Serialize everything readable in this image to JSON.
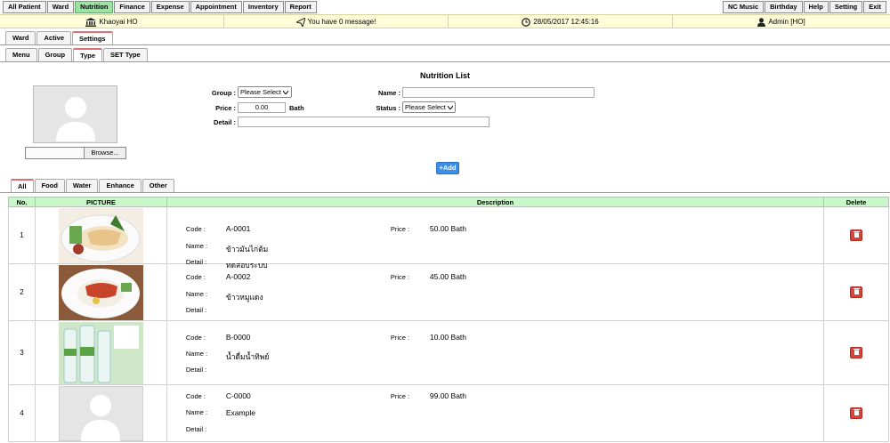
{
  "top_nav": {
    "left": [
      "All Patient",
      "Ward",
      "Nutrition",
      "Finance",
      "Expense",
      "Appointment",
      "Inventory",
      "Report"
    ],
    "right": [
      "NC Music",
      "Birthday",
      "Help",
      "Setting",
      "Exit"
    ],
    "active": "Nutrition"
  },
  "info_bar": {
    "branch": "Khaoyai HO",
    "message": "You have 0 message!",
    "datetime": "28/05/2017 12:45:16",
    "user": "Admin [HO]"
  },
  "tabs_level1": [
    "Ward",
    "Active",
    "Settings"
  ],
  "tabs_level2": [
    "Menu",
    "Group",
    "Type",
    "SET Type"
  ],
  "form": {
    "title": "Nutrition List",
    "group_label": "Group :",
    "group_value": "Please Select",
    "name_label": "Name :",
    "name_value": "",
    "price_label": "Price :",
    "price_value": "0.00",
    "price_unit": "Bath",
    "status_label": "Status :",
    "status_value": "Please Select",
    "detail_label": "Detail :",
    "detail_value": "",
    "browse_label": "Browse...",
    "add_label": "+Add"
  },
  "filter_tabs": [
    "All",
    "Food",
    "Water",
    "Enhance",
    "Other"
  ],
  "table": {
    "headers": [
      "No.",
      "PICTURE",
      "Description",
      "Delete"
    ],
    "code_label": "Code :",
    "name_label": "Name :",
    "detail_label": "Detail :",
    "price_label": "Price :",
    "rows": [
      {
        "no": "1",
        "code": "A-0001",
        "name": "ข้าวมันไก่ต้ม",
        "detail": "ทดสอบระบบ",
        "price": "50.00 Bath",
        "picture": "chicken-rice"
      },
      {
        "no": "2",
        "code": "A-0002",
        "name": "ข้าวหมูแดง",
        "detail": "",
        "price": "45.00 Bath",
        "picture": "red-pork-rice"
      },
      {
        "no": "3",
        "code": "B-0000",
        "name": "น้ำดื่มน้ำทิพย์",
        "detail": "",
        "price": "10.00 Bath",
        "picture": "water-bottles"
      },
      {
        "no": "4",
        "code": "C-0000",
        "name": "Example",
        "detail": "",
        "price": "99.00 Bath",
        "picture": "placeholder"
      }
    ]
  },
  "colors": {
    "active_nav": "#9fe0a6",
    "header_green": "#c9f7c9",
    "info_bg": "#fffcd9",
    "add_blue": "#3b8ee8",
    "delete_red": "#d9443a"
  }
}
